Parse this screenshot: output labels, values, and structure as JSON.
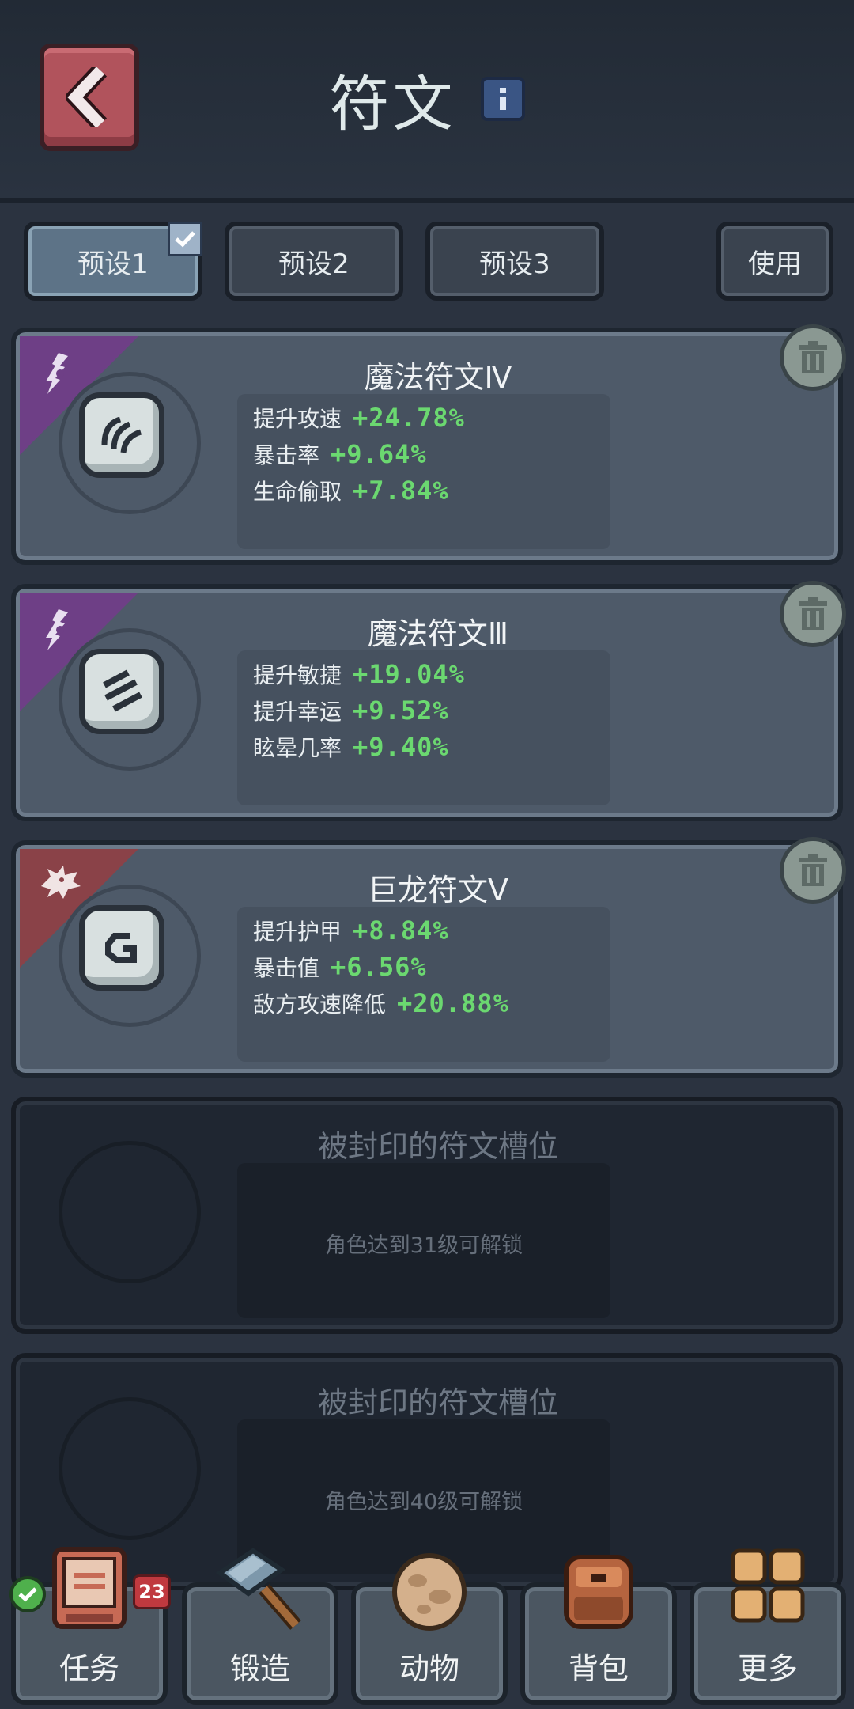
{
  "header": {
    "title": "符文"
  },
  "presets": {
    "tabs": [
      {
        "label": "预设1",
        "selected": true
      },
      {
        "label": "预设2",
        "selected": false
      },
      {
        "label": "预设3",
        "selected": false
      }
    ],
    "use_label": "使用"
  },
  "runes": [
    {
      "name": "魔法符文Ⅳ",
      "category": "magic",
      "glyph": "three-curve-rune-icon",
      "stats": [
        {
          "label": "提升攻速",
          "value": "+24.78%"
        },
        {
          "label": "暴击率",
          "value": "+9.64%"
        },
        {
          "label": "生命偷取",
          "value": "+7.84%"
        }
      ]
    },
    {
      "name": "魔法符文Ⅲ",
      "category": "magic",
      "glyph": "three-stripe-rune-icon",
      "stats": [
        {
          "label": "提升敏捷",
          "value": "+19.04%"
        },
        {
          "label": "提升幸运",
          "value": "+9.52%"
        },
        {
          "label": "眩晕几率",
          "value": "+9.40%"
        }
      ]
    },
    {
      "name": "巨龙符文Ⅴ",
      "category": "dragon",
      "glyph": "hook-rune-icon",
      "stats": [
        {
          "label": "提升护甲",
          "value": "+8.84%"
        },
        {
          "label": "暴击值",
          "value": "+6.56%"
        },
        {
          "label": "敌方攻速降低",
          "value": "+20.88%"
        }
      ]
    }
  ],
  "locked_slots": [
    {
      "title": "被封印的符文槽位",
      "requirement": "角色达到31级可解锁"
    },
    {
      "title": "被封印的符文槽位",
      "requirement": "角色达到40级可解锁"
    }
  ],
  "nav": {
    "items": [
      {
        "label": "任务",
        "icon": "quest-board-icon"
      },
      {
        "label": "锻造",
        "icon": "hammer-icon"
      },
      {
        "label": "动物",
        "icon": "egg-icon"
      },
      {
        "label": "背包",
        "icon": "backpack-icon"
      },
      {
        "label": "更多",
        "icon": "grid-more-icon"
      }
    ],
    "quest_badge": "23"
  },
  "colors": {
    "stat_value": "#6bd870",
    "magic_corner": "#6e3f86",
    "dragon_corner": "#8a4248",
    "back_button": "#b1535c"
  }
}
